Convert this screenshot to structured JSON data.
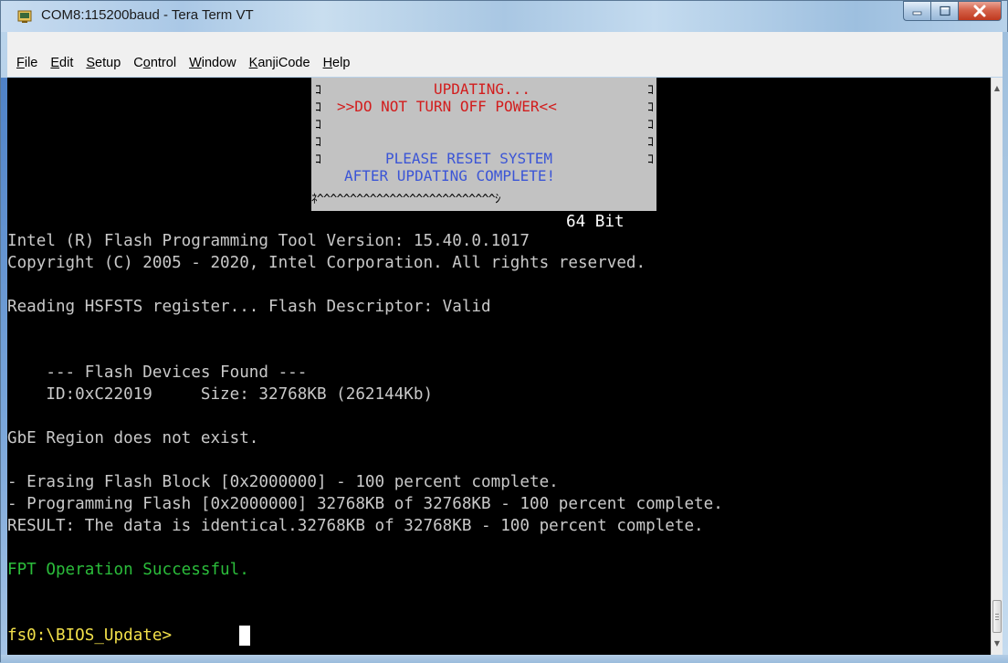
{
  "window": {
    "title": "COM8:115200baud - Tera Term VT"
  },
  "menu": {
    "items": [
      {
        "mnemonic": "F",
        "rest": "ile"
      },
      {
        "mnemonic": "E",
        "rest": "dit"
      },
      {
        "mnemonic": "S",
        "rest": "etup"
      },
      {
        "pre": "C",
        "mnemonic": "o",
        "rest": "ntrol"
      },
      {
        "mnemonic": "W",
        "rest": "indow"
      },
      {
        "mnemonic": "K",
        "rest": "anjiCode"
      },
      {
        "mnemonic": "H",
        "rest": "elp"
      }
    ]
  },
  "dialog": {
    "line1": "UPDATING...",
    "line2": ">>DO NOT TURN OFF POWER<<",
    "line4": "PLEASE RESET SYSTEM",
    "line5": "AFTER UPDATING COMPLETE!",
    "bottom_border": "ﾈ^^^^^^^^^^^^^^^^^^^^^^^^^^^ｼ",
    "side_char": "ｺ"
  },
  "terminal": {
    "bit_label": "64 Bit",
    "lines": [
      "Intel (R) Flash Programming Tool Version: 15.40.0.1017",
      "Copyright (C) 2005 - 2020, Intel Corporation. All rights reserved.",
      "Reading HSFSTS register... Flash Descriptor: Valid",
      "    --- Flash Devices Found ---",
      "    ID:0xC22019     Size: 32768KB (262144Kb)",
      "GbE Region does not exist.",
      "- Erasing Flash Block [0x2000000] - 100 percent complete.",
      "- Programming Flash [0x2000000] 32768KB of 32768KB - 100 percent complete.",
      "RESULT: The data is identical.32768KB of 32768KB - 100 percent complete."
    ],
    "success": "FPT Operation Successful.",
    "prompt": "fs0:\\BIOS_Update> "
  },
  "colors": {
    "dialog_red": "#d21d1d",
    "dialog_blue": "#3b55d6",
    "success_green": "#2bbd3b",
    "prompt_yellow": "#f2e04a"
  }
}
